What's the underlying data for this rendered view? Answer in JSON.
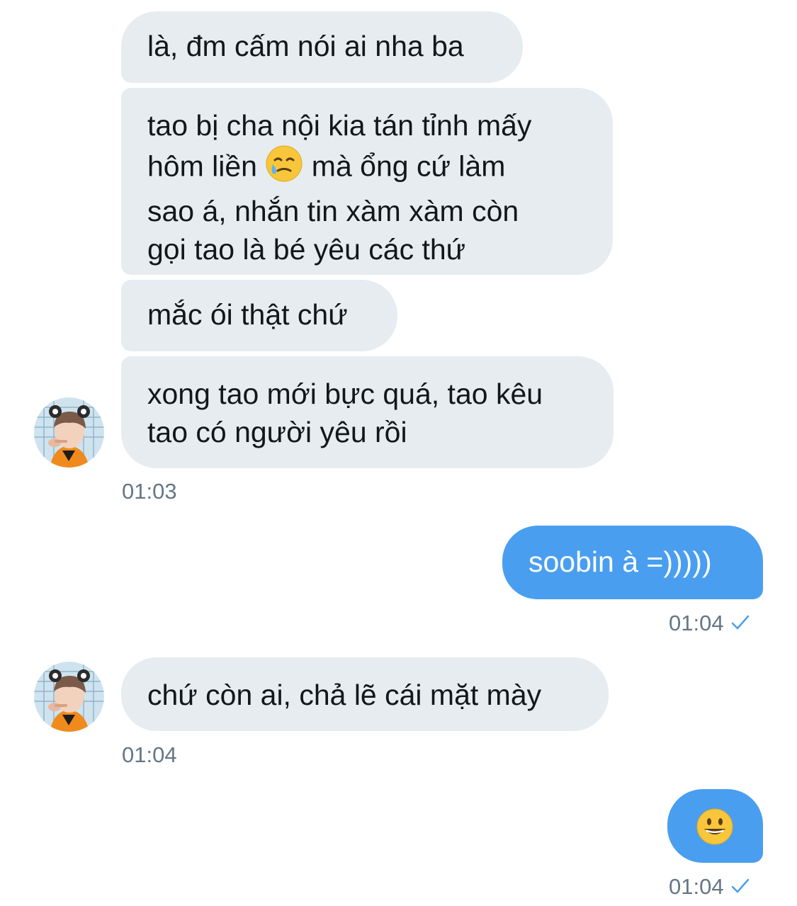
{
  "conversation": {
    "messages": [
      {
        "side": "in",
        "lines": [
          "là, đm cấm nói ai nha ba"
        ]
      },
      {
        "side": "in",
        "lines": [
          "tao bị cha nội kia tán tỉnh mấy",
          "hôm liền",
          "sao á, nhắn tin xàm xàm còn",
          "gọi tao là bé yêu các thứ"
        ],
        "line2_after_emoji": "mà ổng cứ làm",
        "emoji": "crying-smile"
      },
      {
        "side": "in",
        "lines": [
          "mắc ói thật chứ"
        ]
      },
      {
        "side": "in",
        "lines": [
          "xong tao mới bực quá, tao kêu",
          "tao có người yêu rồi"
        ],
        "time": "01:03"
      },
      {
        "side": "out",
        "lines": [
          "soobin à =)))))"
        ],
        "time": "01:04",
        "status": "sent"
      },
      {
        "side": "in",
        "lines": [
          "chứ còn ai, chả lẽ cái mặt mày"
        ],
        "time": "01:04"
      },
      {
        "side": "out",
        "emoji": "grinning-face",
        "time": "01:04",
        "status": "sent"
      }
    ]
  },
  "colors": {
    "incoming_bubble": "#e6ecf0",
    "outgoing_bubble": "#4a9ef0",
    "timestamp": "#657786",
    "check": "#4a9ef0"
  }
}
